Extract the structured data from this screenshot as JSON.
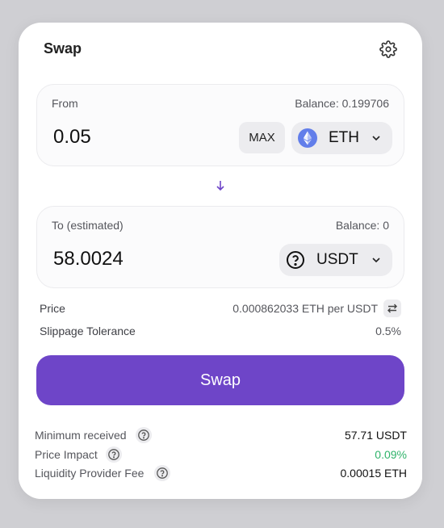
{
  "header": {
    "title": "Swap",
    "settings_icon": "gear-icon"
  },
  "from": {
    "label": "From",
    "balance": "Balance: 0.199706",
    "amount": "0.05",
    "max_label": "MAX",
    "token": "ETH",
    "token_icon": "ethereum-icon"
  },
  "direction_icon": "arrow-down-icon",
  "to": {
    "label": "To (estimated)",
    "balance": "Balance: 0",
    "amount": "58.0024",
    "token": "USDT",
    "token_icon": "question-circle-icon"
  },
  "price": {
    "label": "Price",
    "value": "0.000862033 ETH per USDT"
  },
  "slippage": {
    "label": "Slippage Tolerance",
    "value": "0.5%"
  },
  "swap_button": "Swap",
  "details": {
    "minimum_received": {
      "label": "Minimum received",
      "value": "57.71 USDT"
    },
    "price_impact": {
      "label": "Price Impact",
      "value": "0.09%"
    },
    "lp_fee": {
      "label": "Liquidity Provider Fee",
      "value": "0.00015 ETH"
    }
  },
  "colors": {
    "accent": "#6e45c8",
    "positive": "#2fb36a",
    "eth": "#627eea"
  }
}
